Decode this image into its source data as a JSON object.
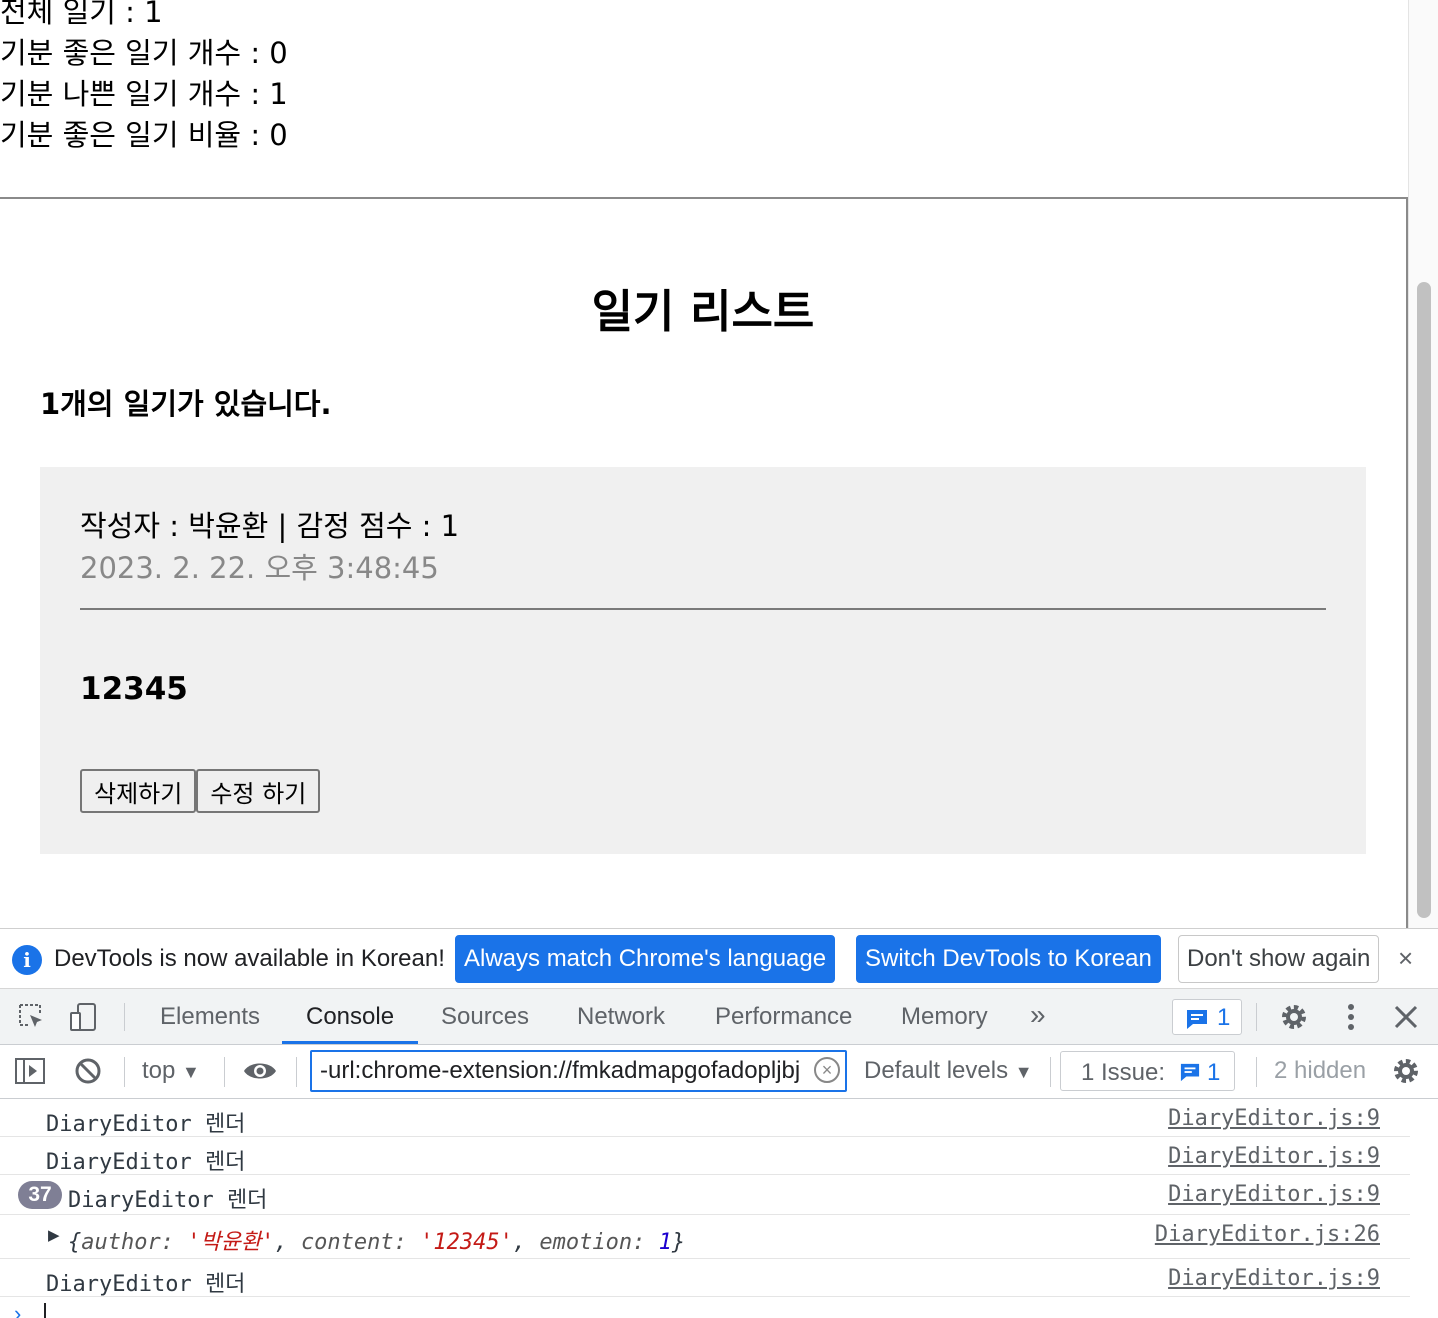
{
  "stats": {
    "total": "전체 일기 : 1",
    "good": "기분 좋은 일기 개수 : 0",
    "bad": "기분 나쁜 일기 개수 : 1",
    "ratio": "기분 좋은 일기 비율 : 0"
  },
  "diary_list": {
    "title": "일기 리스트",
    "count_text": "1개의 일기가 있습니다.",
    "items": [
      {
        "info": "작성자 : 박윤환 | 감정 점수 : 1",
        "date": "2023. 2. 22. 오후 3:48:45",
        "content": "12345",
        "delete_label": "삭제하기",
        "edit_label": "수정 하기"
      }
    ]
  },
  "devtools": {
    "infobar": {
      "text": "DevTools is now available in Korean!",
      "btn_match": "Always match Chrome's language",
      "btn_switch": "Switch DevTools to Korean",
      "btn_dont_show": "Don't show again",
      "close": "×"
    },
    "tabs": [
      "Elements",
      "Console",
      "Sources",
      "Network",
      "Performance",
      "Memory"
    ],
    "more_tabs": "»",
    "messages_badge": "1",
    "filter": {
      "context": "top",
      "value": "-url:chrome-extension://fmkadmapgofadopljbj",
      "levels": "Default levels",
      "issues_label": "1 Issue:",
      "issues_count": "1",
      "hidden": "2 hidden"
    },
    "console_logs": [
      {
        "message": "DiaryEditor 렌더",
        "source": "DiaryEditor.js:9"
      },
      {
        "message": "DiaryEditor 렌더",
        "source": "DiaryEditor.js:9"
      },
      {
        "repeat": "37",
        "message": "DiaryEditor 렌더",
        "source": "DiaryEditor.js:9"
      },
      {
        "object": {
          "author": "'박윤환'",
          "content": "'12345'",
          "emotion": "1"
        },
        "source": "DiaryEditor.js:26"
      },
      {
        "message": "DiaryEditor 렌더",
        "source": "DiaryEditor.js:9"
      }
    ],
    "colors": {
      "accent": "#1a73e8",
      "string": "#c41a16",
      "number": "#1c00cf"
    }
  }
}
